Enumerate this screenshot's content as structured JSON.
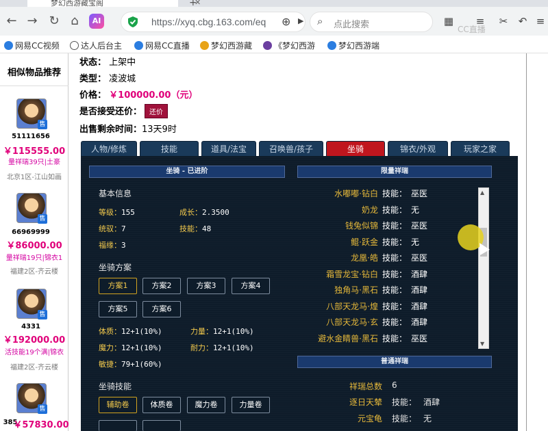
{
  "browser": {
    "tab_title": "梦幻西游藏宝阁",
    "url": "https://xyq.cbg.163.com/eq",
    "search_placeholder": "点此搜索",
    "bookmarks": [
      "网易CC视频",
      "达人后台主",
      "网易CC直播",
      "梦幻西游藏",
      "《梦幻西游",
      "梦幻西游端"
    ],
    "watermark": "CC直播"
  },
  "sidebar": {
    "title": "相似物品推荐",
    "items": [
      {
        "id": "51111656",
        "price": "￥115555.00",
        "desc": "量祥瑞39只|土豪",
        "server": "北京1区-江山如画"
      },
      {
        "id": "66969999",
        "price": "￥86000.00",
        "desc": "量祥瑞19只|锦衣1",
        "server": "福建2区-齐云楼"
      },
      {
        "id": "4331",
        "price": "￥192000.00",
        "desc": "活技能19个满|锦衣",
        "server": "福建2区-齐云楼"
      },
      {
        "id": "385",
        "price": "￥57830.00",
        "desc": "",
        "server": ""
      }
    ]
  },
  "info": {
    "status_label": "状态：",
    "status_value": "上架中",
    "type_label": "类型：",
    "type_value": "凌波城",
    "price_label": "价格：",
    "price_value": "￥100000.00（元）",
    "counter_label": "是否接受还价：",
    "counter_button": "还价",
    "remaining_label": "出售剩余时间：",
    "remaining_value": "13天9时"
  },
  "tabs": [
    "人物/修炼",
    "技能",
    "道具/法宝",
    "召唤兽/孩子",
    "坐骑",
    "锦衣/外观",
    "玩家之家"
  ],
  "mount": {
    "header": "坐骑 - 已进阶",
    "basic_title": "基本信息",
    "level_label": "等级：",
    "level_value": "155",
    "growth_label": "成长：",
    "growth_value": "2.3500",
    "controller_label": "统驭：",
    "controller_value": "7",
    "skill_label": "技能：",
    "skill_value": "48",
    "luck_label": "福缘：",
    "luck_value": "3",
    "plan_title": "坐骑方案",
    "plans": [
      "方案1",
      "方案2",
      "方案3",
      "方案4",
      "方案5",
      "方案6"
    ],
    "attrs": [
      {
        "label": "体质：",
        "value": "12+1(10%)"
      },
      {
        "label": "力量：",
        "value": "12+1(10%)"
      },
      {
        "label": "魔力：",
        "value": "12+1(10%)"
      },
      {
        "label": "耐力：",
        "value": "12+1(10%)"
      },
      {
        "label": "敏捷：",
        "value": "79+1(60%)"
      }
    ],
    "skills_title": "坐骑技能",
    "skill_buttons": [
      "辅助卷",
      "体质卷",
      "魔力卷",
      "力量卷"
    ]
  },
  "limited": {
    "header": "限量祥瑞",
    "skill_word": "技能：",
    "rows": [
      {
        "name": "水嘟嘟·钻白",
        "skill": "巫医"
      },
      {
        "name": "奶龙",
        "skill": "无"
      },
      {
        "name": "钱兔似锦",
        "skill": "巫医"
      },
      {
        "name": "鲲·跃金",
        "skill": "无"
      },
      {
        "name": "龙凰·皓",
        "skill": "巫医"
      },
      {
        "name": "霜雪龙宝·钻白",
        "skill": "酒肆"
      },
      {
        "name": "独角马·黑石",
        "skill": "酒肆"
      },
      {
        "name": "八部天龙马·煌",
        "skill": "酒肆"
      },
      {
        "name": "八部天龙马·玄",
        "skill": "酒肆"
      },
      {
        "name": "避水金睛兽·黑石",
        "skill": "巫医"
      }
    ]
  },
  "normal": {
    "header": "普通祥瑞",
    "total_label": "祥瑞总数",
    "total_value": "6",
    "rows": [
      {
        "name": "逐日天辇",
        "skill": "酒肆"
      },
      {
        "name": "元宝龟",
        "skill": "无"
      }
    ]
  }
}
